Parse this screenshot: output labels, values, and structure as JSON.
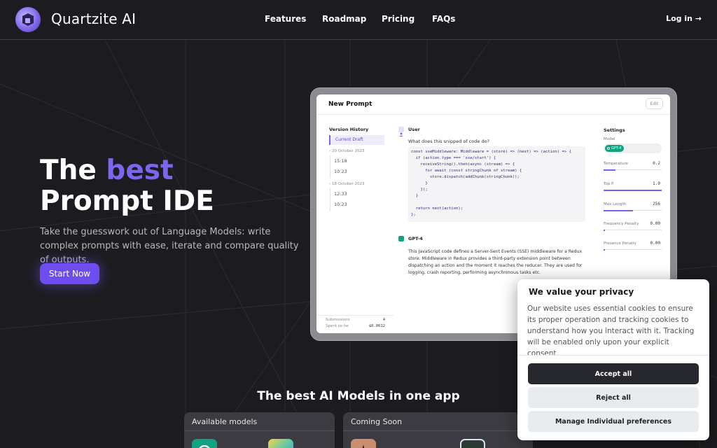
{
  "brand": {
    "name": "Quartzite AI"
  },
  "nav": {
    "items": [
      {
        "label": "Features"
      },
      {
        "label": "Roadmap"
      },
      {
        "label": "Pricing"
      },
      {
        "label": "FAQs"
      }
    ],
    "login": "Log in →"
  },
  "hero": {
    "title_the": "The ",
    "title_accent": "best",
    "title_line2": "Prompt IDE",
    "subtitle": "Take the guesswork out of Language Models: write complex prompts with ease, iterate and compare quality of outputs.",
    "cta": "Start Now"
  },
  "app": {
    "title": "New Prompt",
    "edit": "Edit",
    "version_history": {
      "title": "Version History",
      "current": "Current Draft",
      "groups": [
        {
          "date": "20 October 2023",
          "times": [
            "15:18",
            "10:23"
          ]
        },
        {
          "date": "18 October 2023",
          "times": [
            "12:33",
            "10:23"
          ]
        }
      ]
    },
    "user_label": "User",
    "question": "What does this snipped of code do?",
    "code": "const sseMiddleware: Middleware = (store) => (next) => (action) => {\n  if (action.type === 'sse/start') {\n    receiveString().then(async (stream) => {\n      for await (const stringChunk of stream) {\n        store.dispatch(addChunk(stringChunk));\n      }\n    });\n  }\n\n  return next(action);\n};",
    "assistant_label": "GPT-4",
    "answer": "This JavaScript code defines a Server-Sent Events (SSE) middleware for a Redux store. Middleware in Redux provides a third-party extension point between dispatching an action and the moment it reaches the reducer. They are used for logging, crash reporting, performing asynchronous tasks etc.",
    "settings": {
      "title": "Settings",
      "model_label": "Model",
      "model_value": "GPT-4",
      "params": [
        {
          "label": "Temperature",
          "value": "0.2",
          "level": 0.2
        },
        {
          "label": "Top P",
          "value": "1.0",
          "level": 1.0
        },
        {
          "label": "Max Length",
          "value": "256",
          "level": 0.5
        },
        {
          "label": "Frequency Penalty",
          "value": "0.00",
          "level": 0.0
        },
        {
          "label": "Presence Penalty",
          "value": "0.00",
          "level": 0.0
        }
      ]
    },
    "footer": {
      "submissions_label": "Submissions",
      "submissions_value": "4",
      "spent_label": "Spent so far",
      "spent_value": "$0.0012"
    }
  },
  "models_section": {
    "heading": "The best AI Models in one app",
    "available": "Available models",
    "coming": "Coming Soon"
  },
  "cookie": {
    "title": "We value your privacy",
    "text": "Our website uses essential cookies to ensure its proper operation and tracking cookies to understand how you interact with it. Tracking will be enabled only upon your explicit consent.",
    "accept": "Accept all",
    "reject": "Reject all",
    "manage": "Manage Individual preferences"
  },
  "colors": {
    "accent": "#7d65f0",
    "button": "#6d4cf0",
    "background": "#1c1c20",
    "gpt_green": "#10a37f"
  }
}
